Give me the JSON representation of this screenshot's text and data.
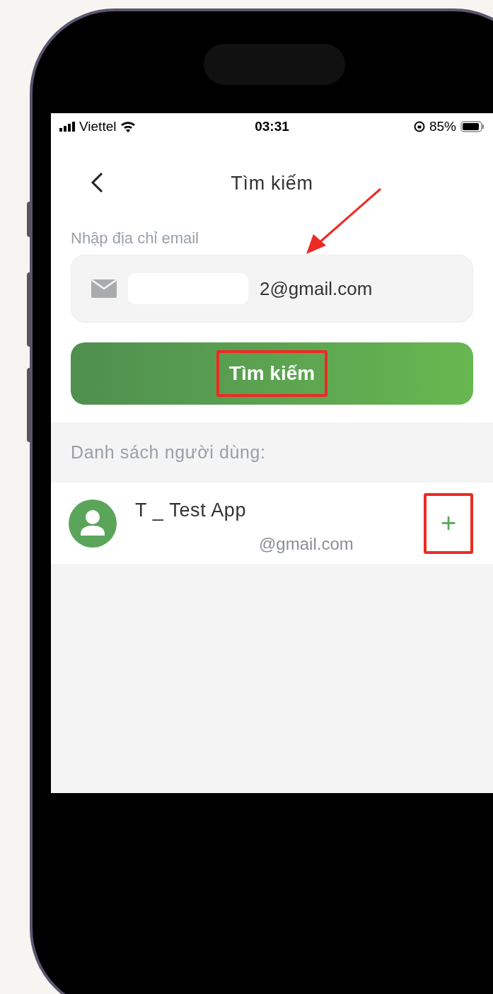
{
  "status_bar": {
    "carrier": "Viettel",
    "time": "03:31",
    "battery": "85%"
  },
  "nav": {
    "title": "Tìm kiếm"
  },
  "email_field": {
    "label": "Nhập địa chỉ email",
    "value": "2@gmail.com",
    "redacted": true,
    "pointer": true
  },
  "search_button": {
    "label": "Tìm kiếm",
    "highlighted": true
  },
  "users": {
    "heading": "Danh sách người dùng:",
    "items": [
      {
        "name": "T _ Test App",
        "email": "@gmail.com",
        "add_label": "+",
        "highlighted": true
      }
    ]
  }
}
